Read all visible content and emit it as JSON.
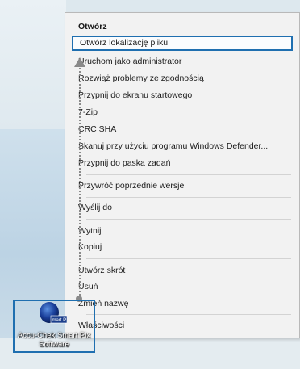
{
  "context_menu": {
    "items": [
      {
        "label": "Otwórz",
        "bold": true
      },
      {
        "label": "Otwórz lokalizację pliku",
        "selected": true
      },
      {
        "label": "Uruchom jako administrator"
      },
      {
        "label": "Rozwiąż problemy ze zgodnością"
      },
      {
        "label": "Przypnij do ekranu startowego"
      },
      {
        "label": "7-Zip"
      },
      {
        "label": "CRC SHA"
      },
      {
        "label": "Skanuj przy użyciu programu Windows Defender..."
      },
      {
        "label": "Przypnij do paska zadań"
      },
      {
        "label": "Przywróć poprzednie wersje"
      },
      {
        "label": "Wyślij do"
      },
      {
        "label": "Wytnij"
      },
      {
        "label": "Kopiuj"
      },
      {
        "label": "Utwórz skrót"
      },
      {
        "label": "Usuń"
      },
      {
        "label": "Zmień nazwę"
      },
      {
        "label": "Właściwości"
      }
    ]
  },
  "desktop_icon": {
    "name": "accu-chek-app-icon",
    "label": "Accu-Chek Smart Pix Software",
    "badge_text": "mart P"
  },
  "colors": {
    "selection_border": "#1f6fb0",
    "menu_bg": "#f2f2f2",
    "pointer": "#8a8a8a"
  }
}
